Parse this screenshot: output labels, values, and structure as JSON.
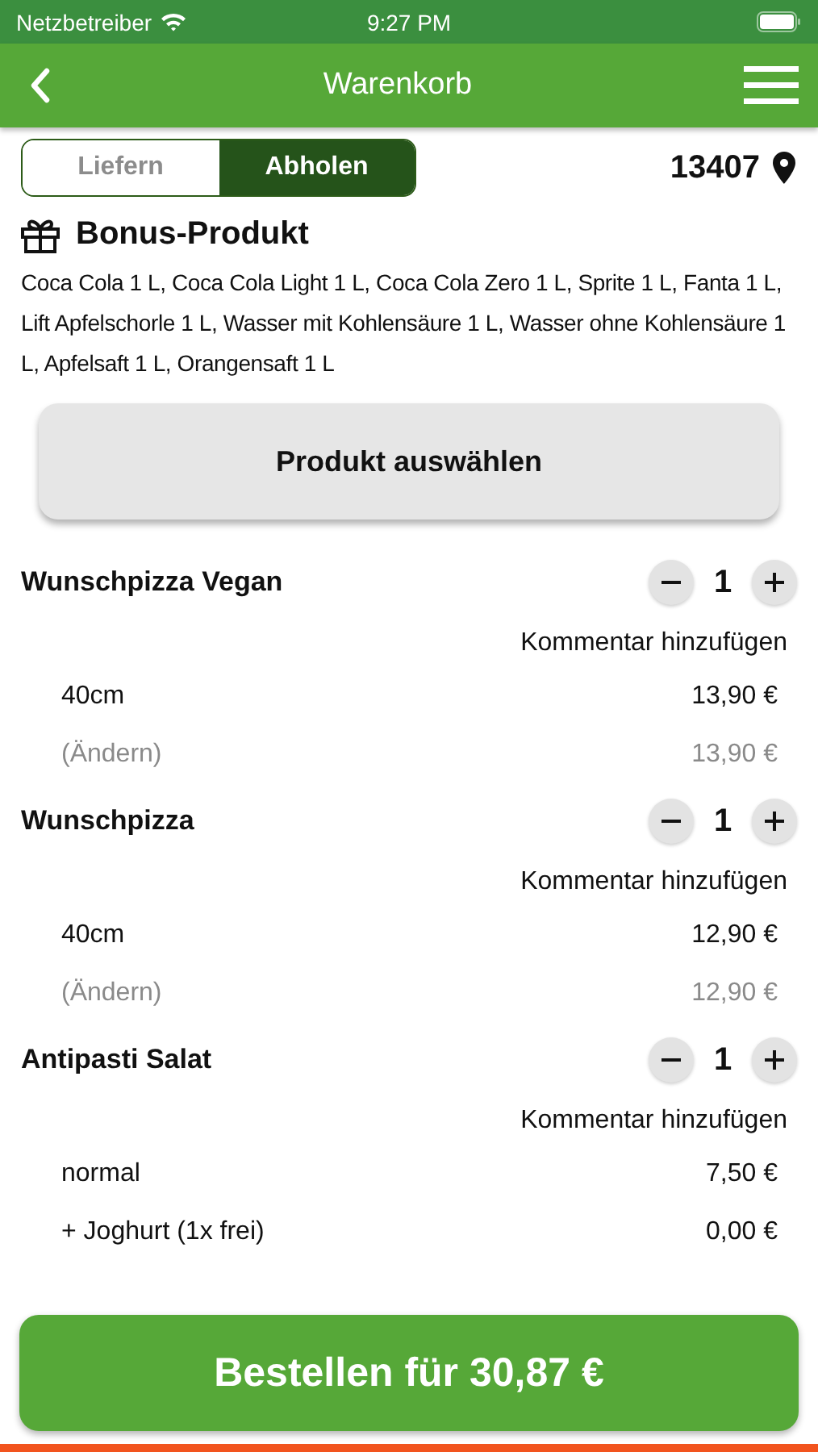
{
  "status_bar": {
    "carrier": "Netzbetreiber",
    "time": "9:27 PM"
  },
  "nav_bar": {
    "title": "Warenkorb"
  },
  "mode_tabs": [
    {
      "label": "Liefern",
      "selected": false
    },
    {
      "label": "Abholen",
      "selected": true
    }
  ],
  "postal_code": "13407",
  "bonus": {
    "title": "Bonus-Produkt",
    "text": "Coca Cola 1 L, Coca Cola Light 1 L, Coca Cola Zero 1 L, Sprite 1 L, Fanta 1 L, Lift Apfelschorle 1 L, Wasser mit Kohlensäure 1 L, Wasser ohne Kohlensäure 1 L, Apfelsaft 1 L, Orangensaft 1 L",
    "button": "Produkt auswählen"
  },
  "items": [
    {
      "name": "Wunschpizza Vegan",
      "quantity": "1",
      "comment_link": "Kommentar hinzufügen",
      "lines": [
        {
          "kind": "option",
          "label": "40cm",
          "price": "13,90 €"
        },
        {
          "kind": "change",
          "label": "(Ändern)",
          "price": "13,90 €"
        }
      ]
    },
    {
      "name": "Wunschpizza",
      "quantity": "1",
      "comment_link": "Kommentar hinzufügen",
      "lines": [
        {
          "kind": "option",
          "label": "40cm",
          "price": "12,90 €"
        },
        {
          "kind": "change",
          "label": "(Ändern)",
          "price": "12,90 €"
        }
      ]
    },
    {
      "name": "Antipasti Salat",
      "quantity": "1",
      "comment_link": "Kommentar hinzufügen",
      "lines": [
        {
          "kind": "option",
          "label": "normal",
          "price": "7,50 €"
        },
        {
          "kind": "option",
          "label": "+ Joghurt (1x frei)",
          "price": "0,00 €"
        }
      ]
    }
  ],
  "order_button": "Bestellen für 30,87 €"
}
